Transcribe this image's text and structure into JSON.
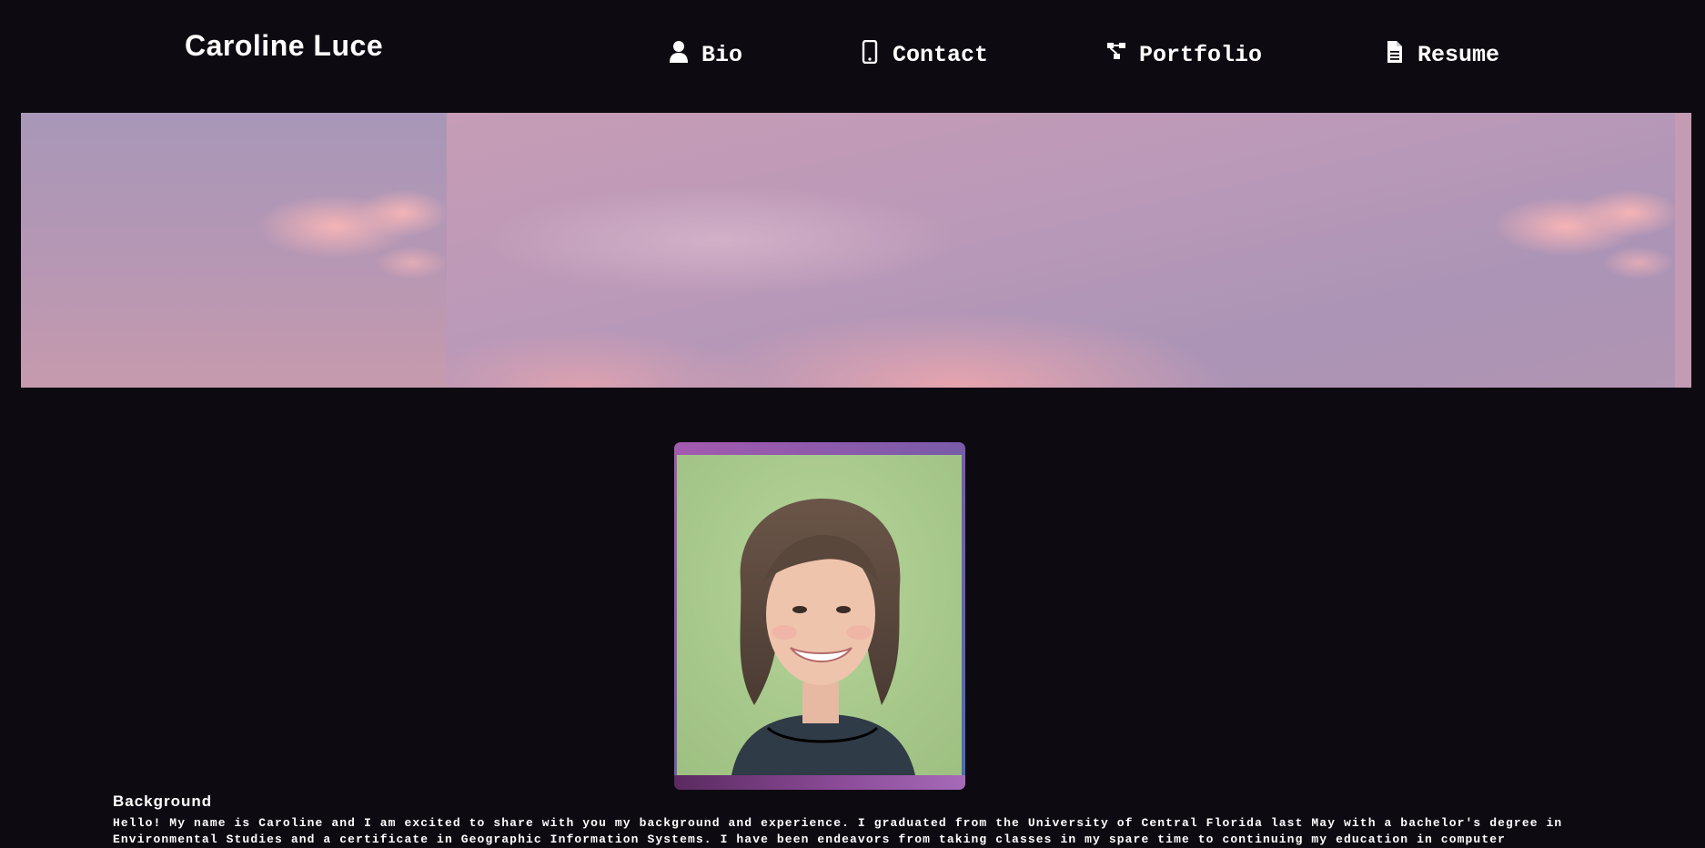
{
  "site": {
    "title": "Caroline Luce"
  },
  "nav": {
    "items": [
      {
        "label": "Bio",
        "icon": "user-icon"
      },
      {
        "label": "Contact",
        "icon": "mobile-phone-icon"
      },
      {
        "label": "Portfolio",
        "icon": "sitemap-icon"
      },
      {
        "label": "Resume",
        "icon": "document-icon"
      }
    ]
  },
  "hero": {
    "image": "pink-purple-sky-clouds-banner"
  },
  "profile": {
    "image": "portrait-photo-smiling-woman"
  },
  "background": {
    "heading": "Background",
    "text": "Hello! My name is Caroline and I am excited to share with you my background and experience. I graduated from the University of Central Florida last May with a bachelor's degree in Environmental Studies and a certificate in Geographic Information Systems. I have been endeavors from taking classes in my spare time to continuing my education in computer"
  },
  "colors": {
    "page_background": "#0e0a11",
    "text": "#ffffff",
    "frame_gradient_start": "#a45ab0",
    "frame_gradient_end": "#4a6ab5"
  }
}
